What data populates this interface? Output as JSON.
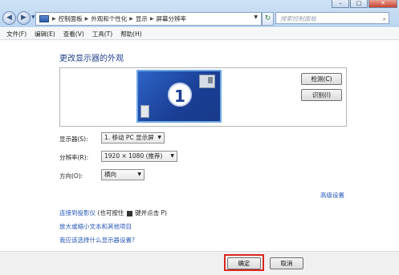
{
  "addressbar": {
    "crumbs": [
      "控制面板",
      "外观和个性化",
      "显示",
      "屏幕分辨率"
    ],
    "search_placeholder": "搜索控制面板"
  },
  "window_buttons": {
    "minimize": "–",
    "maximize": "□",
    "close": "✕"
  },
  "menu": [
    "文件(F)",
    "编辑(E)",
    "查看(V)",
    "工具(T)",
    "帮助(H)"
  ],
  "page_title": "更改显示器的外观",
  "monitor_number": "1",
  "buttons": {
    "detect": "检测(C)",
    "identify": "识别(I)",
    "ok": "确定",
    "cancel": "取消"
  },
  "fields": {
    "display": {
      "label": "显示器(S):",
      "value": "1. 移动 PC 显示屏"
    },
    "resolution": {
      "label": "分辨率(R):",
      "value": "1920 × 1080 (推荐)"
    },
    "orientation": {
      "label": "方向(O):",
      "value": "横向"
    }
  },
  "links": {
    "advanced": "高级设置",
    "projector": "连接到投影仪",
    "projector_hint_pre": "(也可按住",
    "projector_hint_post": "键并点击 P)",
    "text_size": "放大或缩小文本和其他项目",
    "which_settings": "我应该选择什么显示器设置?"
  }
}
